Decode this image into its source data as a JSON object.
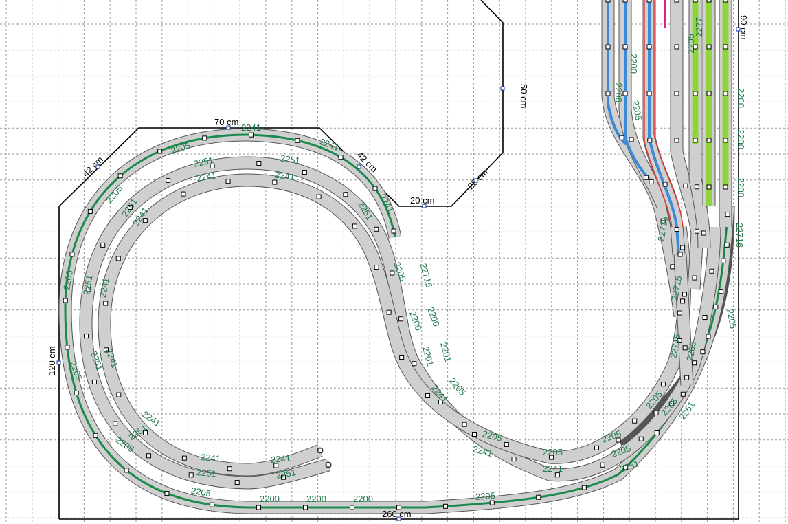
{
  "dimensions": {
    "top_width": "70 cm",
    "left_diag": "42 cm",
    "right_diag": "42 cm",
    "right_cut_width": "20 cm",
    "notch_diag": "28 cm",
    "notch_height": "50 cm",
    "left_height": "120 cm",
    "bottom_width": "260 cm",
    "right_height": "90 cm"
  },
  "track_labels": {
    "outer_top_a": "2241",
    "outer_top_b": "2205",
    "outer_top_c": "2241",
    "outer_left_a": "2205",
    "outer_left_b": "2205",
    "outer_left_c": "2205",
    "outer_left_d": "2205",
    "outer_bottom_a": "2205",
    "outer_bottom_b": "2200",
    "outer_bottom_c": "2200",
    "outer_bottom_d": "2200",
    "outer_bottom_e": "2205",
    "mid_top_a": "2251",
    "mid_top_b": "2251",
    "mid_left_a": "2251",
    "mid_left_b": "2251",
    "mid_left_c": "2251",
    "mid_left_d": "2251",
    "mid_bottom_a": "2251",
    "mid_bottom_b": "2251",
    "inner_top_a": "2241",
    "inner_top_b": "2241",
    "inner_left_a": "2241",
    "inner_left_b": "2241",
    "inner_left_c": "2241",
    "inner_left_d": "2241",
    "inner_bottom_a": "2241",
    "inner_bottom_b": "2241",
    "s_curve_a": "2251",
    "s_curve_b": "2241",
    "s_curve_c": "22715",
    "s_curve_d": "2205",
    "s_curve_e": "2200",
    "s_curve_f": "2200",
    "s_curve_g": "2201",
    "s_curve_h": "2201",
    "s_curve_i": "2205",
    "s_curve_j": "2241",
    "lower_loop_a": "2205",
    "lower_loop_b": "2205",
    "lower_loop_c": "2205",
    "lower_loop_d": "2241",
    "lower_loop_e": "2241",
    "lower_loop_f": "2205",
    "lower_loop_g": "2205",
    "lower_loop_h": "2205",
    "lower_loop_i": "2251",
    "lower_loop_j": "2251",
    "right_a": "22715",
    "right_b": "22715",
    "right_c": "2205",
    "right_d": "22715",
    "right_e": "2205",
    "yard_a": "2200",
    "yard_b": "2200",
    "yard_c": "2200",
    "yard_d": "22716",
    "yard_e": "2205",
    "yard_f": "2200",
    "yard_g": "2206",
    "yard_h": "2205",
    "yard_i": "2277"
  },
  "colors": {
    "grid": "#9a9a9a",
    "track_bed": "#cfcfcf",
    "track_outline": "#555555",
    "main_line": "#1a8a4a",
    "siding_green": "#8fd43a",
    "selected_blue": "#3a8ad8",
    "selected_red": "#e03a3a",
    "selected_pink": "#e0208a",
    "label": "#1f7a4a"
  }
}
